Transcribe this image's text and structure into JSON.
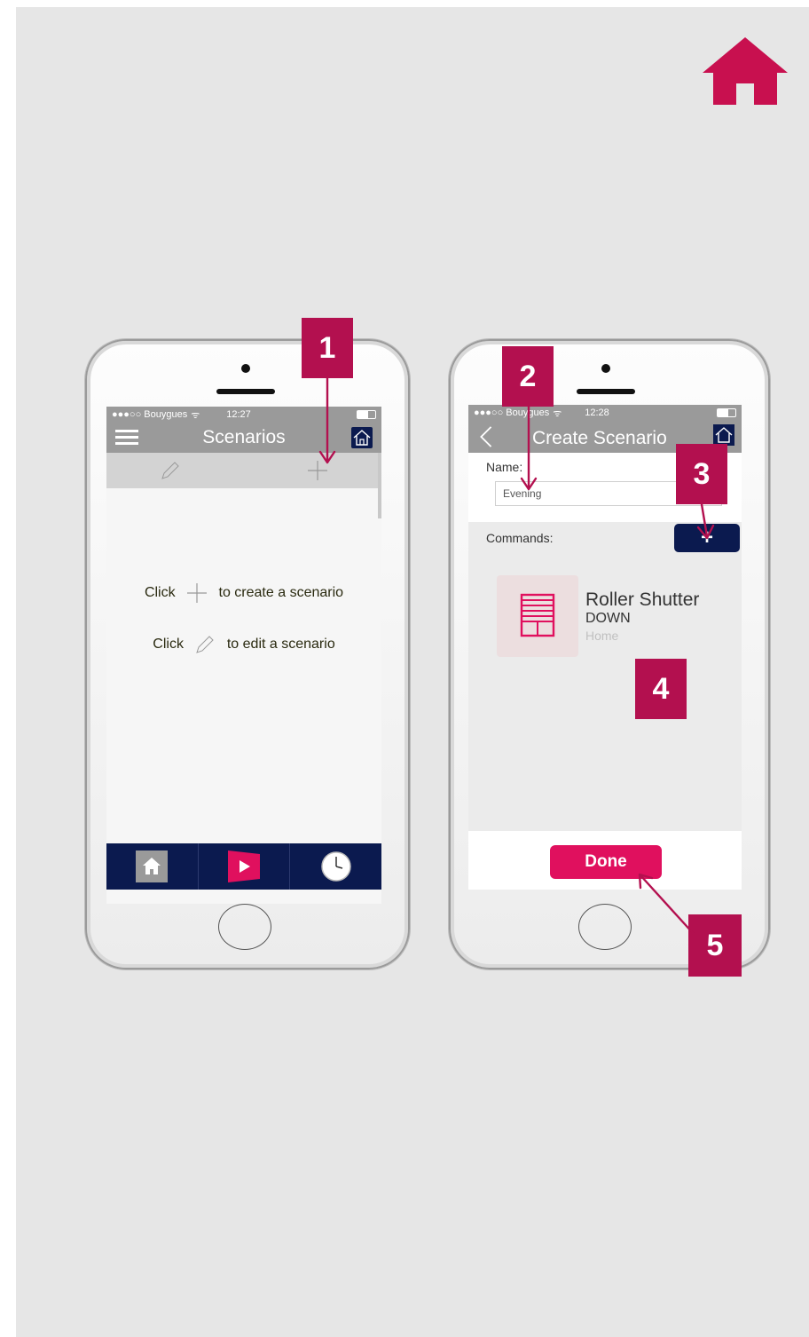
{
  "colors": {
    "accent": "#b3104f",
    "navy": "#0b1a4f",
    "pink": "#e0105e"
  },
  "phone1": {
    "status": {
      "carrier": "●●●○○ Bouygues",
      "time": "12:27"
    },
    "title": "Scenarios",
    "empty_hint": {
      "click_word": "Click",
      "create_text": "to create a scenario",
      "edit_text": "to edit a scenario"
    },
    "tabbar": {
      "icons": [
        "home-icon",
        "play-icon",
        "clock-icon"
      ]
    }
  },
  "phone2": {
    "status": {
      "carrier": "●●●○○ Bouygues",
      "time": "12:28"
    },
    "title": "Create Scenario",
    "name_label": "Name:",
    "name_value": "Evening",
    "commands_label": "Commands:",
    "add_button": "+",
    "command": {
      "title": "Roller Shutter",
      "action": "DOWN",
      "room": "Home"
    },
    "done_label": "Done"
  },
  "callouts": [
    "1",
    "2",
    "3",
    "4",
    "5"
  ]
}
